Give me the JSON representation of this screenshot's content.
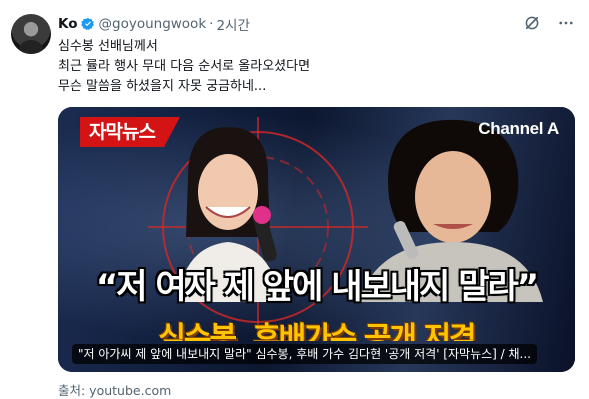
{
  "tweet": {
    "author_name": "Ko",
    "handle": "@goyoungwook",
    "separator": "·",
    "time": "2시간",
    "text_lines": [
      "심수봉 선배님께서",
      "최근 률라 행사 무대 다음 순서로 올라오셨다면",
      "무슨 말씀을 하셨을지 자못 궁금하네..."
    ],
    "verified_color": "#1d9bf0",
    "grok_icon": "grok-icon",
    "more_icon": "more-icon"
  },
  "card": {
    "badge": "자막뉴스",
    "channel": "Channel A",
    "headline": "“저 여자 제 앞에 내보내지 말라”",
    "subheadline": "심수봉, 후배가수 공개 저격",
    "title": "\"저 아가씨 제 앞에 내보내지 말라\" 심수봉, 후배 가수 김다현 '공개 저격' [자막뉴스] / 채...",
    "badge_color": "#d41414",
    "subheadline_color": "#ffc400"
  },
  "source": "출처: youtube.com"
}
